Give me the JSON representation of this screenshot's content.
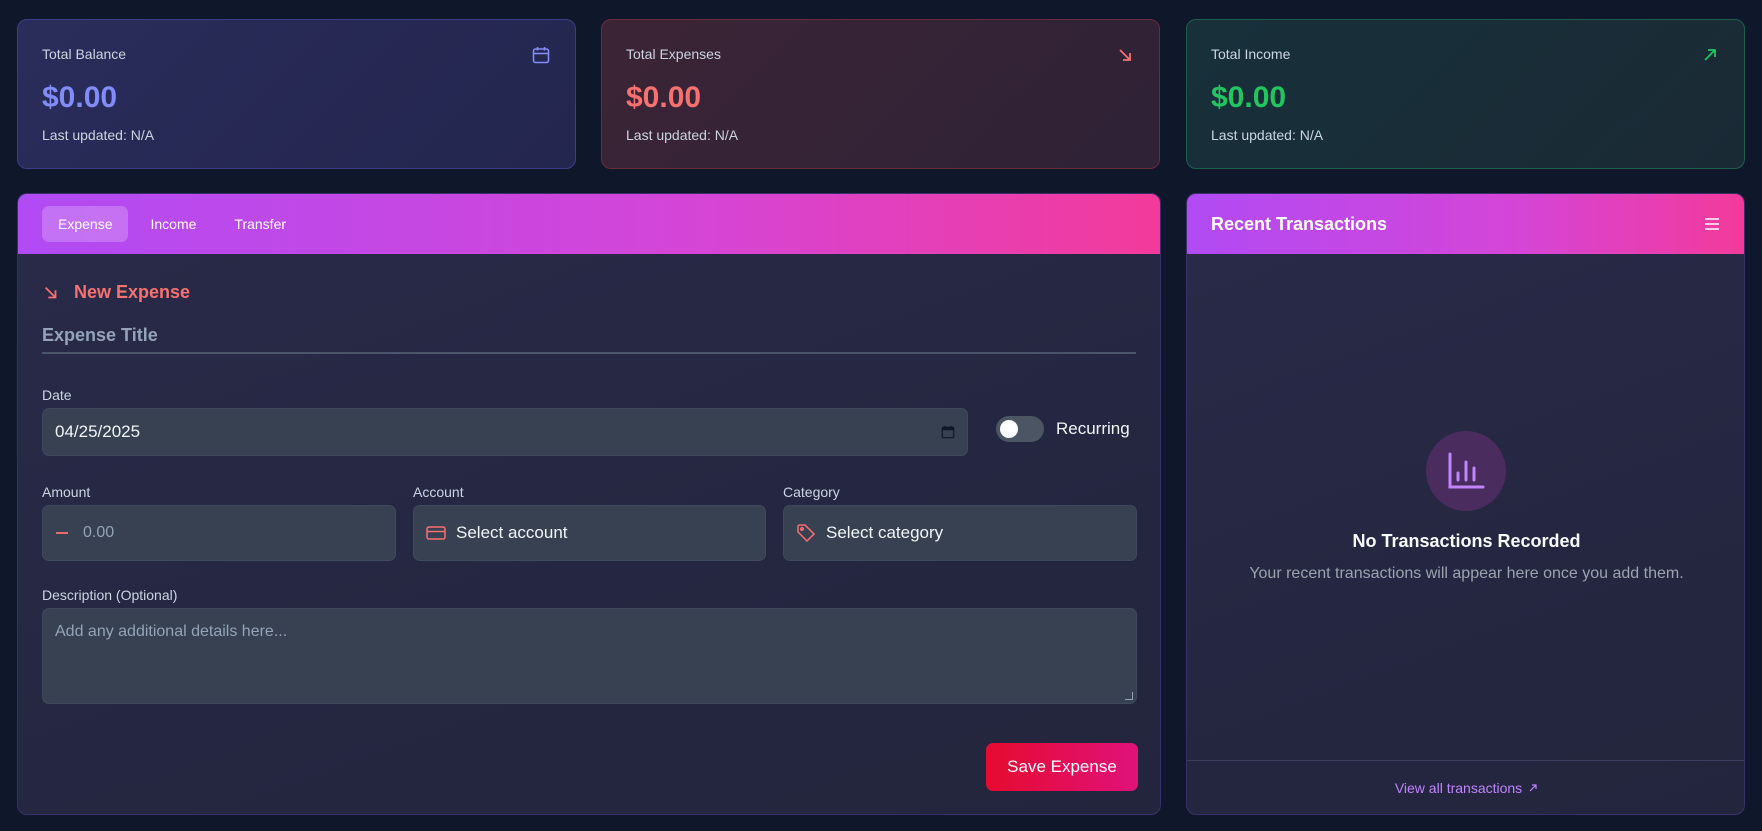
{
  "stats": {
    "balance": {
      "label": "Total Balance",
      "value": "$0.00",
      "updated": "Last updated: N/A",
      "icon": "calendar-icon",
      "color": "#818cf8"
    },
    "expenses": {
      "label": "Total Expenses",
      "value": "$0.00",
      "updated": "Last updated: N/A",
      "icon": "arrow-down-right-icon",
      "color": "#f87171"
    },
    "income": {
      "label": "Total Income",
      "value": "$0.00",
      "updated": "Last updated: N/A",
      "icon": "arrow-up-right-icon",
      "color": "#22c55e"
    }
  },
  "form": {
    "tabs": [
      {
        "label": "Expense",
        "active": true
      },
      {
        "label": "Income",
        "active": false
      },
      {
        "label": "Transfer",
        "active": false
      }
    ],
    "heading": "New Expense",
    "title_placeholder": "Expense Title",
    "date": {
      "label": "Date",
      "value": "04/25/2025"
    },
    "recurring": {
      "label": "Recurring",
      "on": false
    },
    "amount": {
      "label": "Amount",
      "placeholder": "0.00"
    },
    "account": {
      "label": "Account",
      "value": "Select account"
    },
    "category": {
      "label": "Category",
      "value": "Select category"
    },
    "description": {
      "label": "Description (Optional)",
      "placeholder": "Add any additional details here..."
    },
    "save_label": "Save Expense"
  },
  "recent": {
    "title": "Recent Transactions",
    "empty_title": "No Transactions Recorded",
    "empty_subtitle": "Your recent transactions will appear here once you add them.",
    "view_all": "View all transactions"
  },
  "colors": {
    "accent_gradient_start": "#b14bf4",
    "accent_gradient_end": "#f33a9a",
    "expense_red": "#f87171",
    "save_button": "#e60a30"
  }
}
